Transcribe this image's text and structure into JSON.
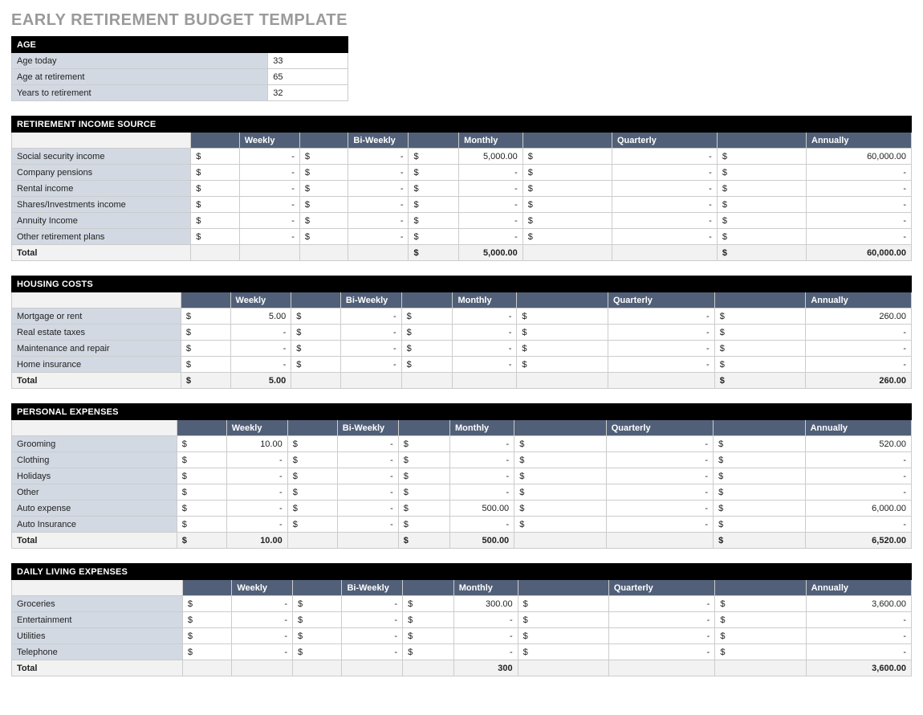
{
  "title": "EARLY RETIREMENT BUDGET TEMPLATE",
  "age": {
    "header": "AGE",
    "rows": [
      {
        "label": "Age today",
        "value": "33"
      },
      {
        "label": "Age at retirement",
        "value": "65"
      },
      {
        "label": "Years to retirement",
        "value": "32"
      }
    ]
  },
  "columns": [
    "Weekly",
    "Bi-Weekly",
    "Monthly",
    "Quarterly",
    "Annually"
  ],
  "total_label": "Total",
  "sections": [
    {
      "title": "RETIREMENT INCOME SOURCE",
      "rows": [
        {
          "label": "Social security income",
          "weekly": "-",
          "biweekly": "-",
          "monthly": "5,000.00",
          "quarterly": "-",
          "annually": "60,000.00"
        },
        {
          "label": "Company pensions",
          "weekly": "-",
          "biweekly": "-",
          "monthly": "-",
          "quarterly": "-",
          "annually": "-"
        },
        {
          "label": "Rental income",
          "weekly": "-",
          "biweekly": "-",
          "monthly": "-",
          "quarterly": "-",
          "annually": "-"
        },
        {
          "label": "Shares/Investments income",
          "weekly": "-",
          "biweekly": "-",
          "monthly": "-",
          "quarterly": "-",
          "annually": "-"
        },
        {
          "label": "Annuity Income",
          "weekly": "-",
          "biweekly": "-",
          "monthly": "-",
          "quarterly": "-",
          "annually": "-"
        },
        {
          "label": "Other retirement plans",
          "weekly": "-",
          "biweekly": "-",
          "monthly": "-",
          "quarterly": "-",
          "annually": "-"
        }
      ],
      "total": {
        "weekly": "",
        "biweekly": "",
        "monthly": "5,000.00",
        "quarterly": "",
        "annually": "60,000.00"
      },
      "total_symbols": {
        "weekly": false,
        "biweekly": false,
        "monthly": true,
        "quarterly": false,
        "annually": true
      }
    },
    {
      "title": "HOUSING COSTS",
      "rows": [
        {
          "label": "Mortgage or rent",
          "weekly": "5.00",
          "biweekly": "-",
          "monthly": "-",
          "quarterly": "-",
          "annually": "260.00"
        },
        {
          "label": "Real estate taxes",
          "weekly": "-",
          "biweekly": "-",
          "monthly": "-",
          "quarterly": "-",
          "annually": "-"
        },
        {
          "label": "Maintenance and repair",
          "weekly": "-",
          "biweekly": "-",
          "monthly": "-",
          "quarterly": "-",
          "annually": "-"
        },
        {
          "label": "Home insurance",
          "weekly": "-",
          "biweekly": "-",
          "monthly": "-",
          "quarterly": "-",
          "annually": "-"
        }
      ],
      "total": {
        "weekly": "5.00",
        "biweekly": "",
        "monthly": "",
        "quarterly": "",
        "annually": "260.00"
      },
      "total_symbols": {
        "weekly": true,
        "biweekly": false,
        "monthly": false,
        "quarterly": false,
        "annually": true
      }
    },
    {
      "title": "PERSONAL EXPENSES",
      "rows": [
        {
          "label": "Grooming",
          "weekly": "10.00",
          "biweekly": "-",
          "monthly": "-",
          "quarterly": "-",
          "annually": "520.00"
        },
        {
          "label": "Clothing",
          "weekly": "-",
          "biweekly": "-",
          "monthly": "-",
          "quarterly": "-",
          "annually": "-"
        },
        {
          "label": "Holidays",
          "weekly": "-",
          "biweekly": "-",
          "monthly": "-",
          "quarterly": "-",
          "annually": "-"
        },
        {
          "label": "Other",
          "weekly": "-",
          "biweekly": "-",
          "monthly": "-",
          "quarterly": "-",
          "annually": "-"
        },
        {
          "label": "Auto expense",
          "weekly": "-",
          "biweekly": "-",
          "monthly": "500.00",
          "quarterly": "-",
          "annually": "6,000.00"
        },
        {
          "label": "Auto Insurance",
          "weekly": "-",
          "biweekly": "-",
          "monthly": "-",
          "quarterly": "-",
          "annually": "-"
        }
      ],
      "total": {
        "weekly": "10.00",
        "biweekly": "",
        "monthly": "500.00",
        "quarterly": "",
        "annually": "6,520.00"
      },
      "total_symbols": {
        "weekly": true,
        "biweekly": false,
        "monthly": true,
        "quarterly": false,
        "annually": true
      }
    },
    {
      "title": "DAILY LIVING EXPENSES",
      "rows": [
        {
          "label": "Groceries",
          "weekly": "-",
          "biweekly": "-",
          "monthly": "300.00",
          "quarterly": "-",
          "annually": "3,600.00"
        },
        {
          "label": "Entertainment",
          "weekly": "-",
          "biweekly": "-",
          "monthly": "-",
          "quarterly": "-",
          "annually": "-"
        },
        {
          "label": "Utilities",
          "weekly": "-",
          "biweekly": "-",
          "monthly": "-",
          "quarterly": "-",
          "annually": "-"
        },
        {
          "label": "Telephone",
          "weekly": "-",
          "biweekly": "-",
          "monthly": "-",
          "quarterly": "-",
          "annually": "-"
        }
      ],
      "total": {
        "weekly": "",
        "biweekly": "",
        "monthly": "300",
        "quarterly": "",
        "annually": "3,600.00"
      },
      "total_symbols": {
        "weekly": false,
        "biweekly": false,
        "monthly": false,
        "quarterly": false,
        "annually": false
      }
    }
  ]
}
